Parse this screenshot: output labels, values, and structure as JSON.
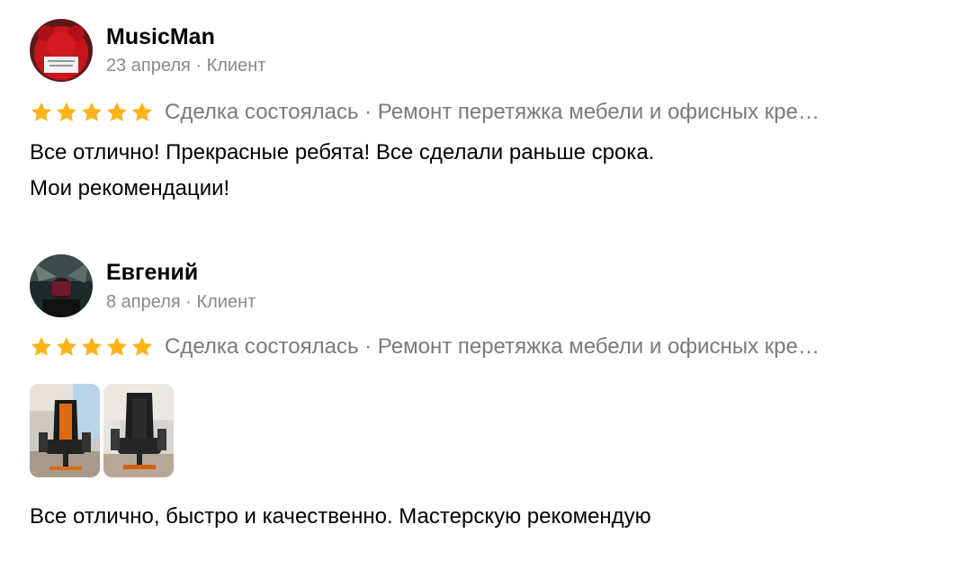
{
  "reviews": [
    {
      "author": "MusicMan",
      "meta": "23 апреля · Клиент",
      "rating": 5,
      "deal": "Сделка состоялась · Ремонт перетяжка мебели и офисных кре…",
      "text_lines": [
        "Все отлично! Прекрасные ребята! Все сделали раньше срока.",
        "Мои рекомендации!"
      ],
      "avatar_icon": "red-teddy-bear-photo"
    },
    {
      "author": "Евгений",
      "meta": "8 апреля · Клиент",
      "rating": 5,
      "deal": "Сделка состоялась · Ремонт перетяжка мебели и офисных кре…",
      "photos": [
        "gaming-chair-orange-photo",
        "gaming-chair-black-photo"
      ],
      "text_lines": [
        "Все отлично, быстро и качественно. Мастерскую рекомендую"
      ],
      "avatar_icon": "dark-portrait-photo"
    }
  ],
  "colors": {
    "star": "#ffb31a",
    "meta": "#8a8a8a",
    "deal": "#7a7a7a"
  }
}
